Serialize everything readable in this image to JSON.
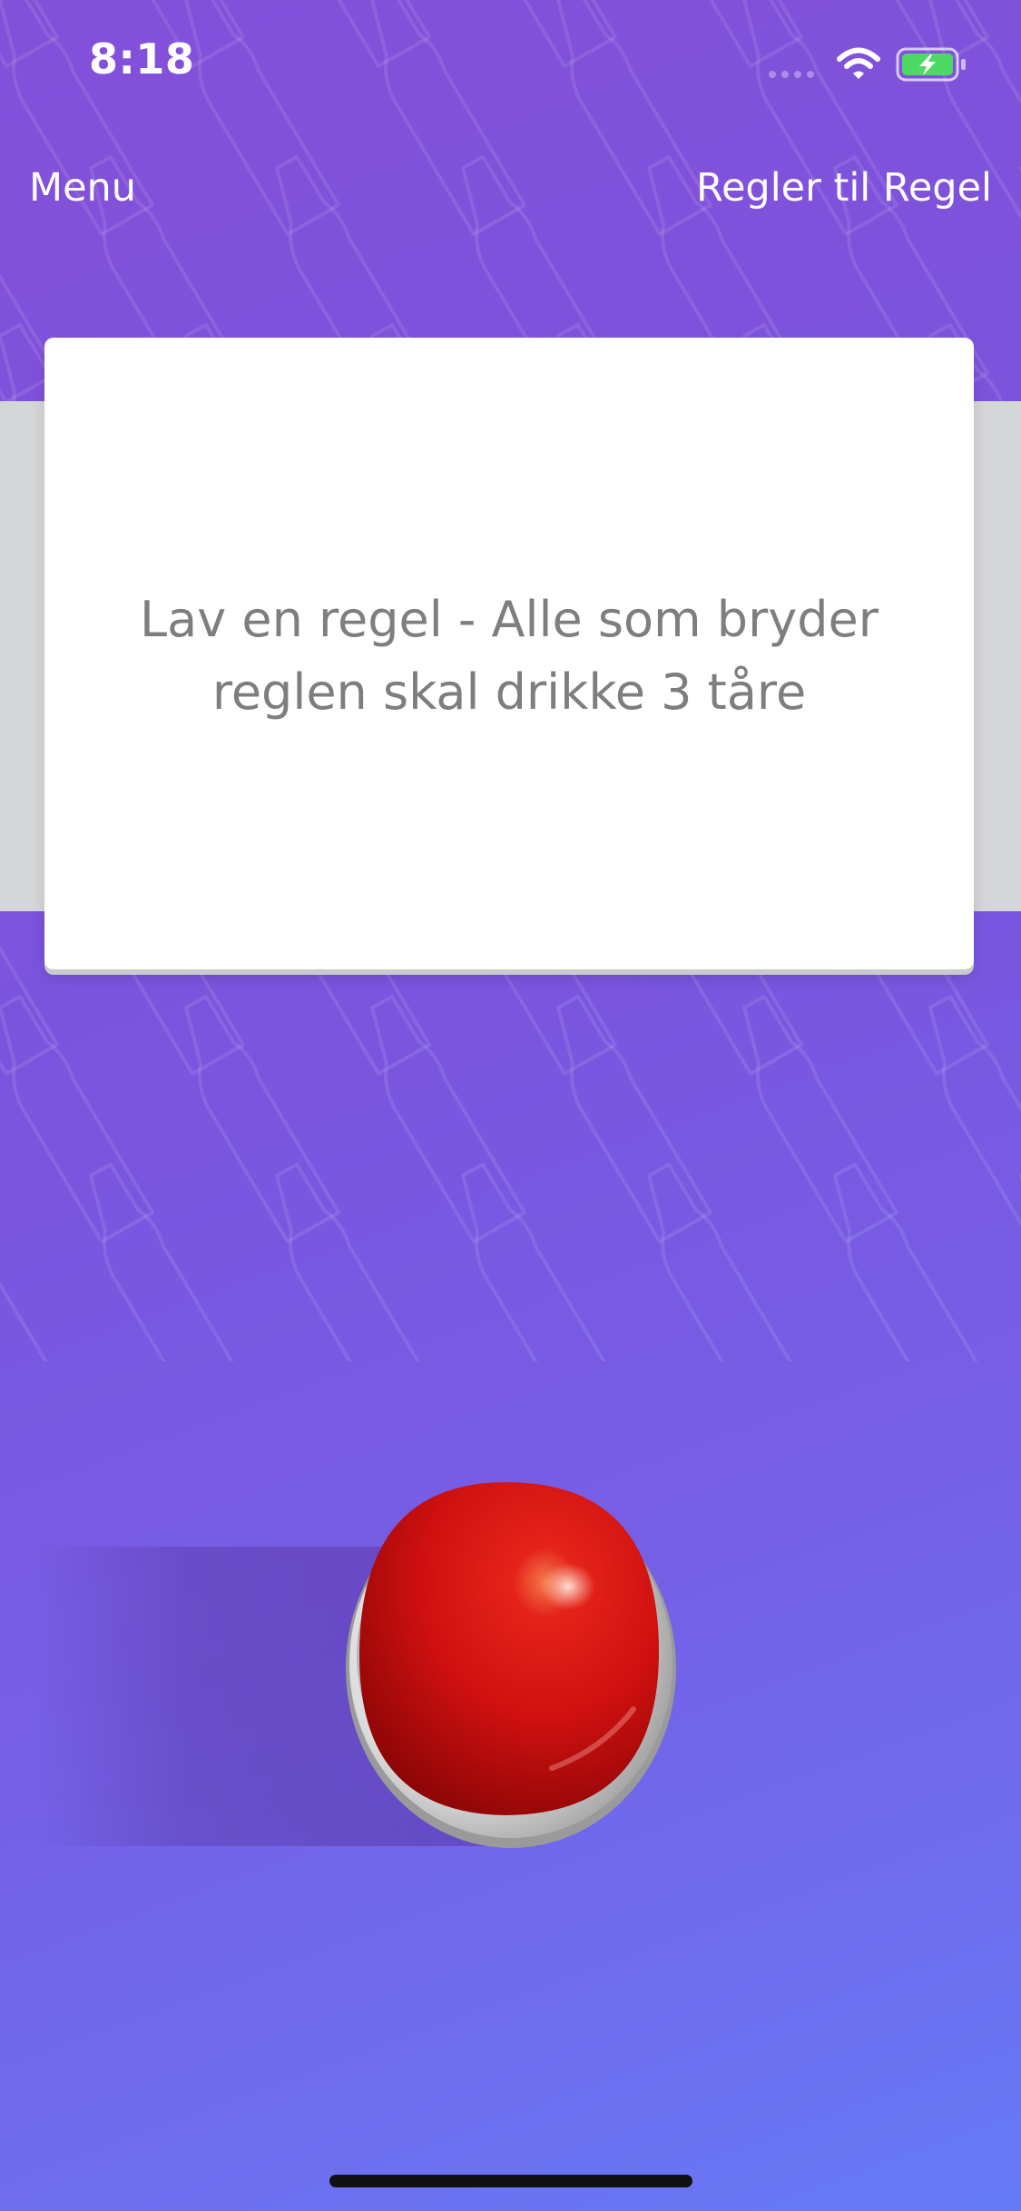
{
  "status_bar": {
    "time": "8:18"
  },
  "nav": {
    "menu_label": "Menu",
    "rules_label": "Regler til Regel"
  },
  "card": {
    "text": "Lav en regel - Alle som bryder reglen skal drikke 3 tåre"
  },
  "colors": {
    "background_top": "#8350D9",
    "background_bottom": "#667AF5",
    "card": "#FFFFFF",
    "card_back": "#D5D6D8",
    "button_red": "#D91313",
    "battery_green": "#4CD964"
  },
  "icons": [
    "signal-icon",
    "wifi-icon",
    "battery-charging-icon",
    "bottle-pattern",
    "red-push-button"
  ]
}
